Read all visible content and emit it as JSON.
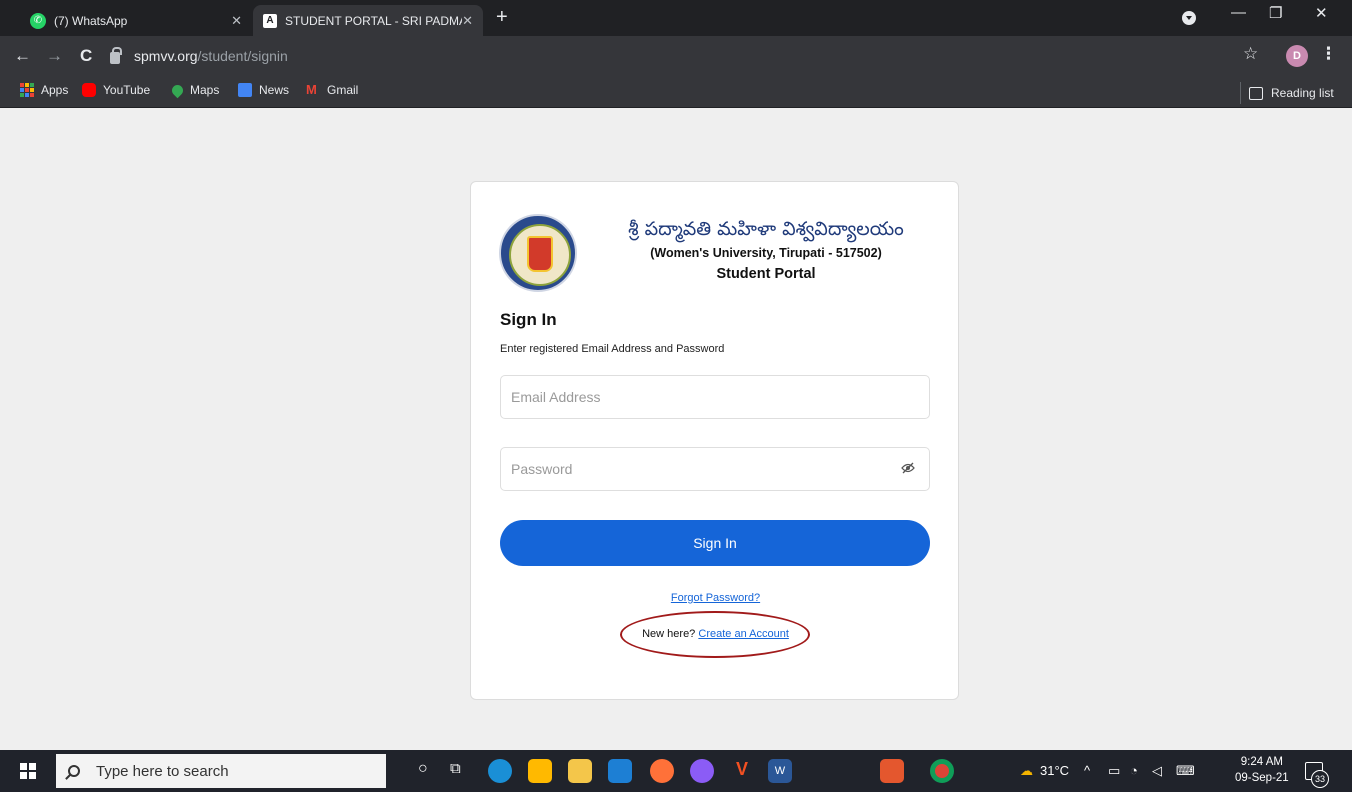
{
  "browser": {
    "tabs": [
      {
        "label": "(7) WhatsApp",
        "favicon": "whatsapp-icon",
        "active": false
      },
      {
        "label": "STUDENT PORTAL - SRI PADMAV",
        "favicon": "angular-icon",
        "active": true
      }
    ],
    "tab_close": "✕",
    "new_tab": "+",
    "url_domain": "spmvv.org",
    "url_path": "/student/signin",
    "profile_initial": "D",
    "bookmarks": [
      {
        "label": "Apps",
        "icon": "apps-grid-icon"
      },
      {
        "label": "YouTube",
        "icon": "youtube-icon"
      },
      {
        "label": "Maps",
        "icon": "maps-icon"
      },
      {
        "label": "News",
        "icon": "news-icon"
      },
      {
        "label": "Gmail",
        "icon": "gmail-icon"
      }
    ],
    "reading_list": "Reading list"
  },
  "portal": {
    "university_telugu": "శ్రీ పద్మావతి మహిళా విశ్వవిద్యాలయం",
    "university_subtitle": "(Women's University, Tirupati - 517502)",
    "portal_title": "Student Portal",
    "heading": "Sign In",
    "instruction": "Enter registered Email Address and Password",
    "email_placeholder": "Email Address",
    "password_placeholder": "Password",
    "signin_button": "Sign In",
    "forgot_password": "Forgot Password?",
    "new_here": "New here?",
    "create_account": "Create an Account",
    "accent_color": "#1565d8"
  },
  "taskbar": {
    "search_placeholder": "Type here to search",
    "weather": "31°C",
    "time": "9:24 AM",
    "date": "09-Sep-21",
    "notification_count": "33"
  }
}
